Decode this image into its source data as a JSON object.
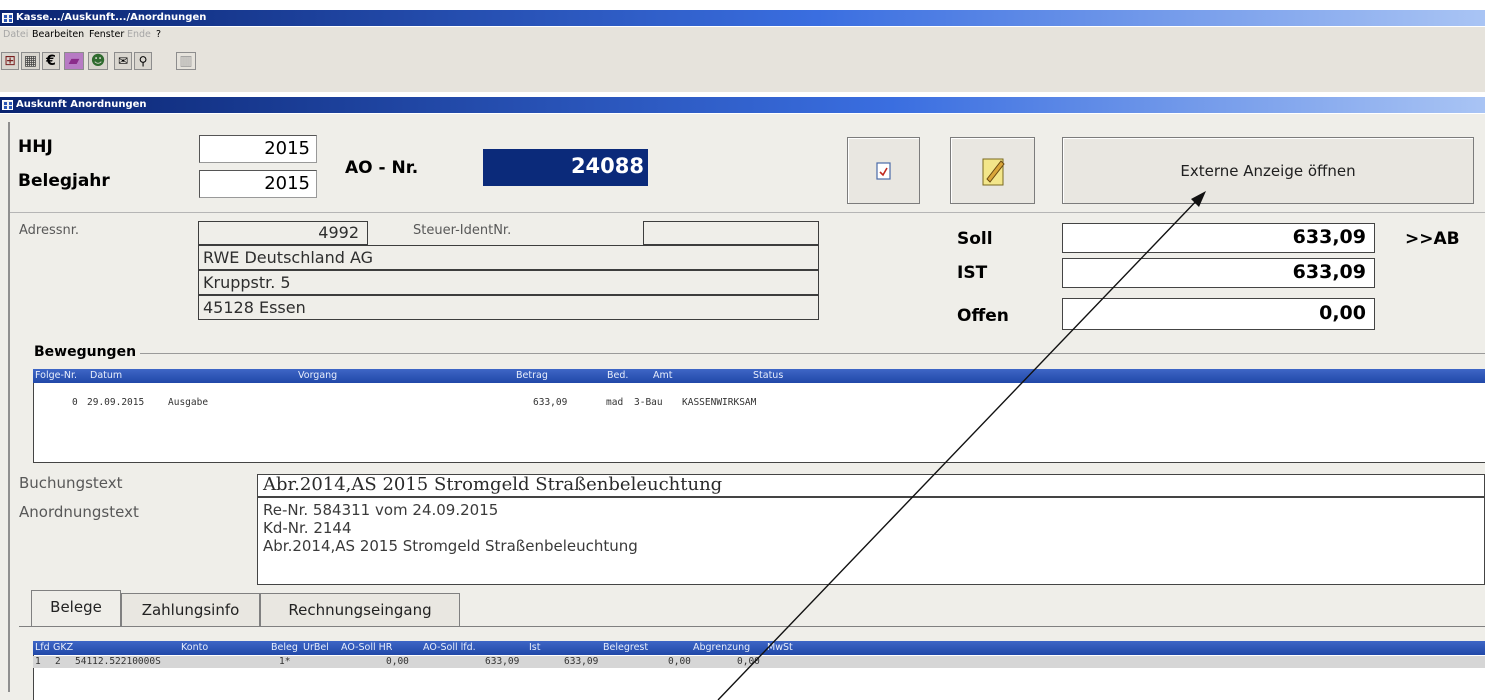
{
  "window": {
    "title": "Kasse.../Auskunft.../Anordnungen"
  },
  "menu": {
    "items": [
      {
        "label": "Datei",
        "enabled": false
      },
      {
        "label": "Bearbeiten",
        "enabled": true
      },
      {
        "label": "Fenster",
        "enabled": true
      },
      {
        "label": "Ende",
        "enabled": false
      },
      {
        "label": "?",
        "enabled": true
      }
    ]
  },
  "toolbar": {
    "buttons": [
      {
        "icon": "grid-icon",
        "glyph": "⊞"
      },
      {
        "icon": "calculator-icon",
        "glyph": "▦"
      },
      {
        "icon": "euro-icon",
        "glyph": "€"
      },
      {
        "icon": "book-icon",
        "glyph": "▰"
      },
      {
        "icon": "people-icon",
        "glyph": "☻"
      },
      {
        "icon": "mail-icon",
        "glyph": "✉"
      },
      {
        "icon": "binoculars-icon",
        "glyph": "⚲"
      },
      {
        "icon": "exit-icon",
        "glyph": "▥"
      }
    ]
  },
  "form": {
    "title": "Auskunft Anordnungen",
    "hhj_label": "HHJ",
    "hhj_value": "2015",
    "belegjahr_label": "Belegjahr",
    "belegjahr_value": "2015",
    "ao_label": "AO - Nr.",
    "ao_value": "24088",
    "extern_button": "Externe Anzeige öffnen",
    "adressnr_label": "Adressnr.",
    "adressnr_value": "4992",
    "steuer_label": "Steuer-IdentNr.",
    "steuer_value": "",
    "address_lines": [
      "RWE Deutschland AG",
      "Kruppstr. 5",
      "45128 Essen"
    ],
    "soll_label": "Soll",
    "soll_value": "633,09",
    "ist_label": "IST",
    "ist_value": "633,09",
    "offen_label": "Offen",
    "offen_value": "0,00",
    "ab_link": ">>AB",
    "bewegungen_title": "Bewegungen",
    "buchungstext_label": "Buchungstext",
    "buchungstext_value": "Abr.2014,AS 2015 Stromgeld Straßenbeleuchtung",
    "anordnungstext_label": "Anordnungstext",
    "anordnungstext_lines": [
      "Re-Nr. 584311 vom 24.09.2015",
      "Kd-Nr. 2144",
      "Abr.2014,AS 2015 Stromgeld Straßenbeleuchtung"
    ]
  },
  "bewegungen": {
    "columns": [
      "Folge-Nr.",
      "Datum",
      "Vorgang",
      "Betrag",
      "Bed.",
      "Amt",
      "Status"
    ],
    "rows": [
      [
        "0",
        "29.09.2015",
        "Ausgabe",
        "633,09",
        "mad",
        "3-Bau",
        "KASSENWIRKSAM"
      ]
    ]
  },
  "tabs": [
    {
      "label": "Belege",
      "active": true
    },
    {
      "label": "Zahlungsinfo",
      "active": false
    },
    {
      "label": "Rechnungseingang",
      "active": false
    }
  ],
  "belege": {
    "columns": [
      "Lfd",
      "GKZ",
      "Konto",
      "Beleg",
      "UrBel",
      "AO-Soll HR",
      "AO-Soll lfd.",
      "Ist",
      "Belegrest",
      "Abgrenzung",
      "MwSt"
    ],
    "rows": [
      [
        "1",
        "2",
        "54112.52210000S",
        "1*",
        "",
        "0,00",
        "633,09",
        "633,09",
        "0,00",
        "0,00",
        ""
      ]
    ]
  },
  "colors": {
    "titlebar": "#0a2470",
    "window_bg": "#efeee9",
    "ao_field_bg": "#0b2a7a",
    "grid_header": "#2148a8"
  }
}
